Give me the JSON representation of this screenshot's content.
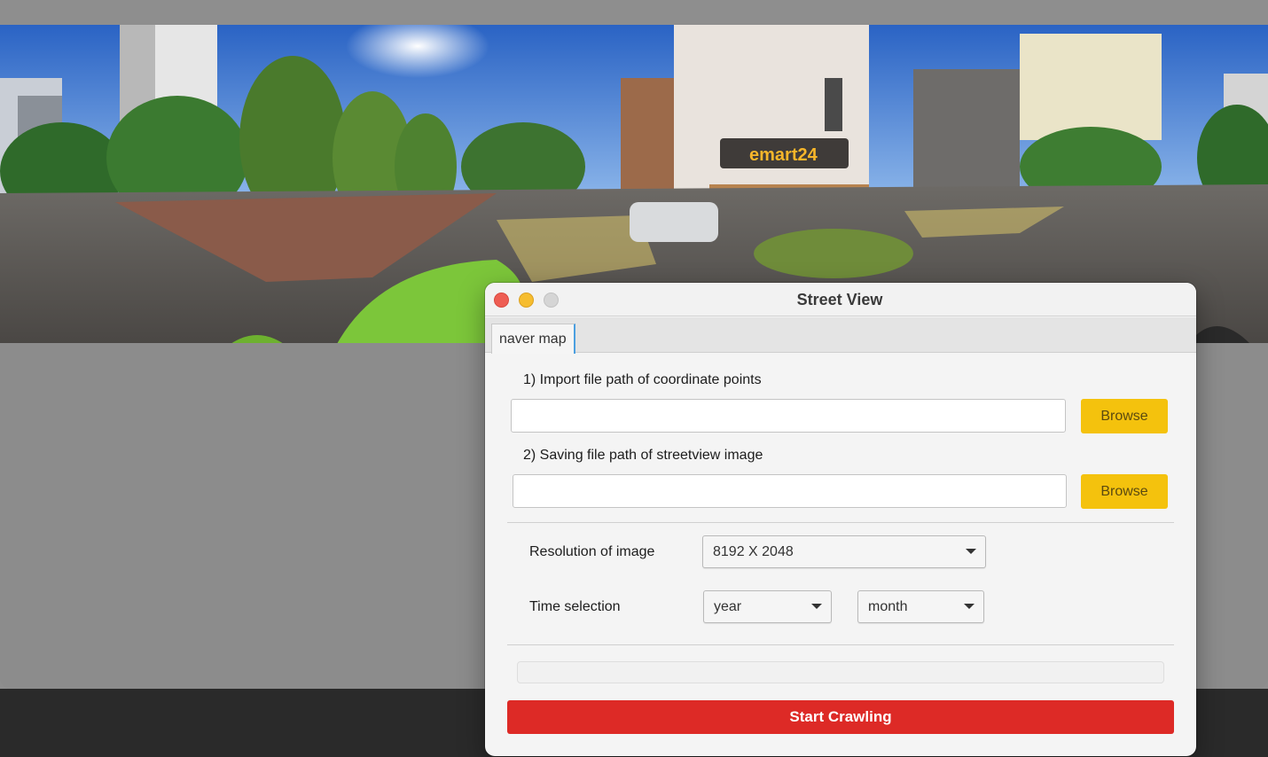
{
  "window": {
    "title": "Street View"
  },
  "tabs": [
    {
      "label": "naver map",
      "active": true
    }
  ],
  "form": {
    "import_label": "1) Import file path of coordinate points",
    "import_value": "",
    "save_label": "2) Saving file path of streetview image",
    "save_value": "",
    "browse_label": "Browse",
    "resolution_label": "Resolution of image",
    "resolution_value": "8192 X 2048",
    "time_label": "Time selection",
    "year_value": "year",
    "month_value": "month"
  },
  "progress": {
    "value": 0
  },
  "actions": {
    "start_label": "Start Crawling"
  },
  "panorama": {
    "sign_text": "emart24"
  },
  "colors": {
    "browse_button": "#f4c20d",
    "start_button": "#dd2a26",
    "close": "#ee5d53",
    "minimize": "#f6bd2f",
    "tab_accent": "#4b9fe0"
  }
}
